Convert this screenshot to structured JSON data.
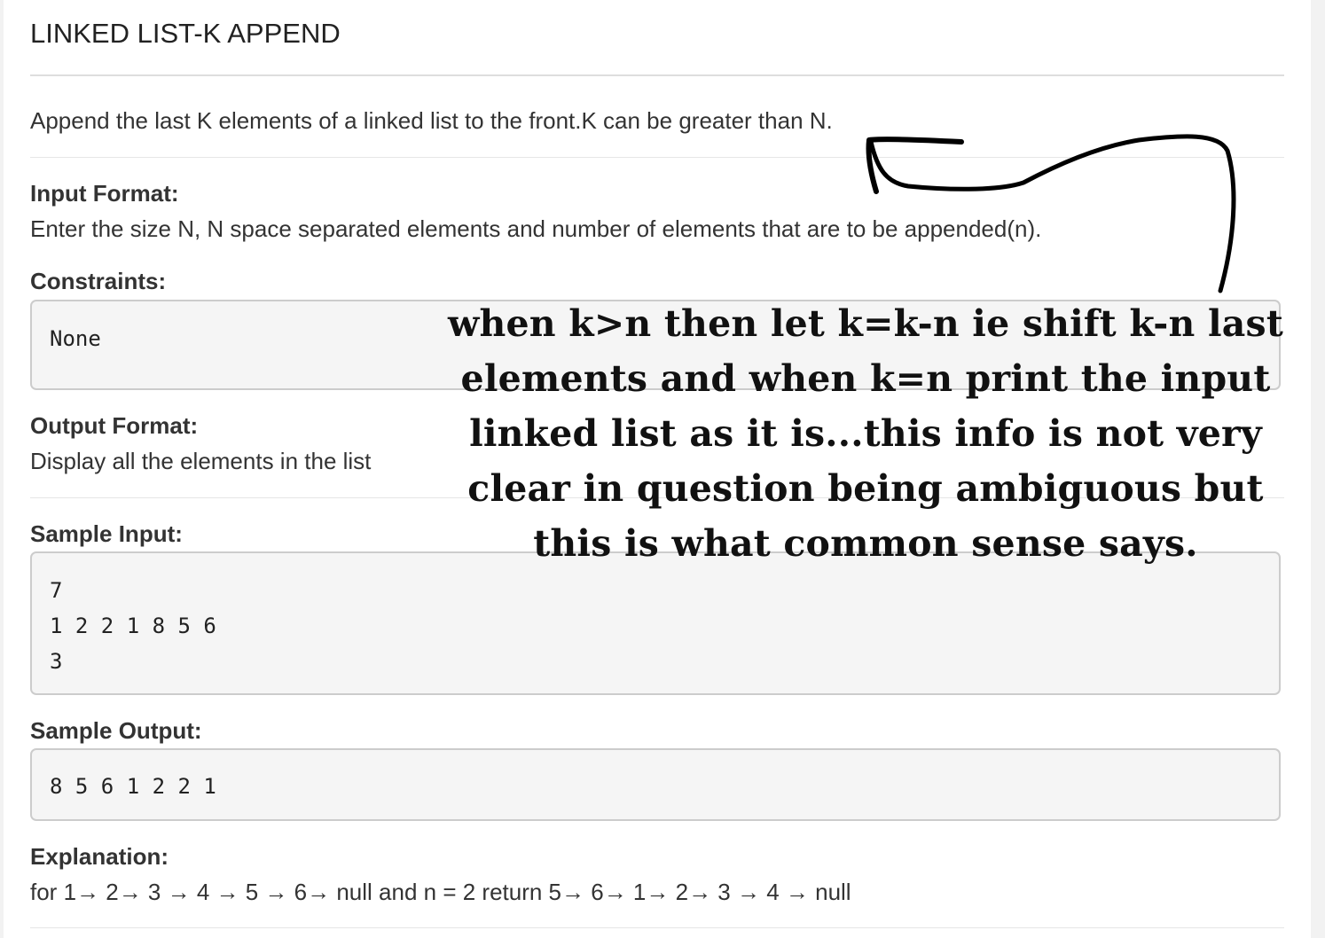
{
  "problem": {
    "title": "LINKED LIST-K APPEND",
    "description": "Append the last K elements of a linked list to the front.K can be greater than N.",
    "input_format": {
      "heading": "Input Format:",
      "text": "Enter the size N, N space separated elements and number of elements that are to be appended(n)."
    },
    "constraints": {
      "heading": "Constraints:",
      "value": "None"
    },
    "output_format": {
      "heading": "Output Format:",
      "text": "Display all the elements in the list"
    },
    "sample_input": {
      "heading": "Sample Input:",
      "lines": [
        "7",
        "1 2 2 1 8 5 6",
        "3"
      ]
    },
    "sample_output": {
      "heading": "Sample Output:",
      "value": "8 5 6 1 2 2 1"
    },
    "explanation": {
      "heading": "Explanation:",
      "text": "for 1→ 2→ 3 → 4 → 5 → 6→ null and n = 2 return 5→ 6→ 1→ 2→ 3 → 4 → null"
    }
  },
  "annotation": {
    "lines": [
      "when k>n then let k=k-n ie shift k-n last",
      "elements and when k=n print the input",
      "linked list as it is...this info is not very",
      "clear in question being ambiguous but",
      "this is what common sense says."
    ],
    "color": "#111111"
  }
}
